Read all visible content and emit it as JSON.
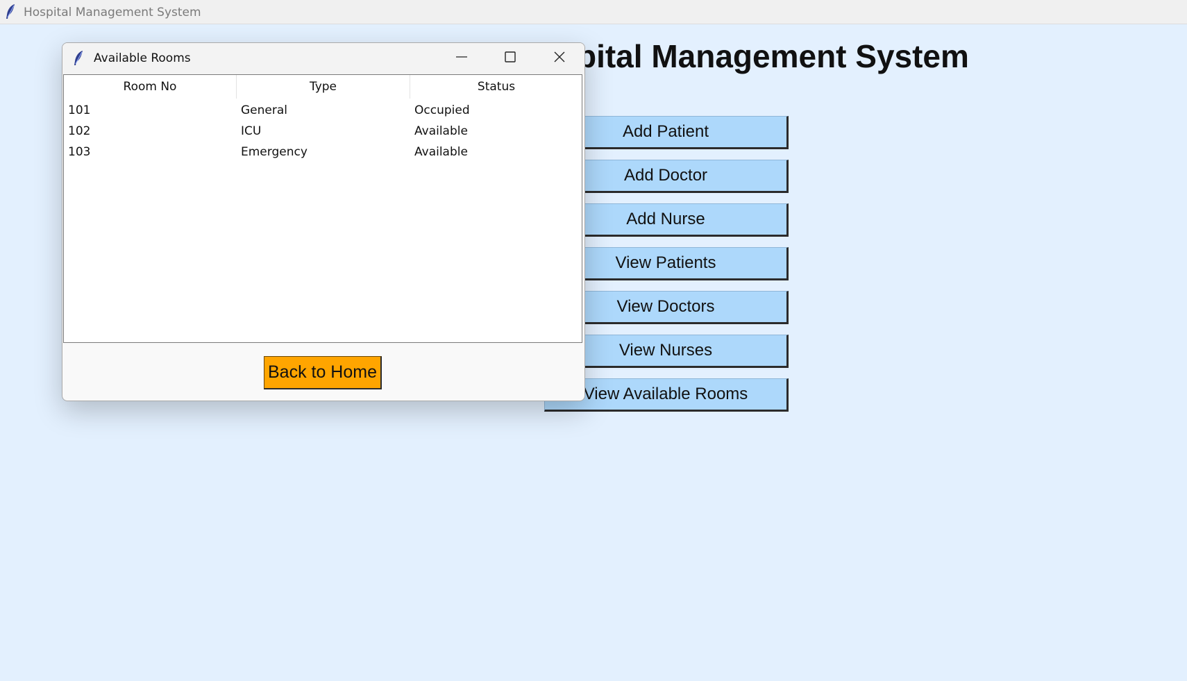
{
  "main_window": {
    "title": "Hospital Management System",
    "heading": "Hospital Management System",
    "background_color": "#e3f0fe",
    "buttons": [
      {
        "label": "Add Patient"
      },
      {
        "label": "Add Doctor"
      },
      {
        "label": "Add Nurse"
      },
      {
        "label": "View Patients"
      },
      {
        "label": "View Doctors"
      },
      {
        "label": "View Nurses"
      },
      {
        "label": "View Available Rooms"
      }
    ],
    "button_color": "#add8fb"
  },
  "dialog": {
    "title": "Available Rooms",
    "columns": [
      "Room No",
      "Type",
      "Status"
    ],
    "rows": [
      [
        "101",
        "General",
        "Occupied"
      ],
      [
        "102",
        "ICU",
        "Available"
      ],
      [
        "103",
        "Emergency",
        "Available"
      ]
    ],
    "back_button_label": "Back to Home",
    "back_button_color": "#ffa500",
    "window_controls": [
      "minimize-icon",
      "maximize-icon",
      "close-icon"
    ]
  }
}
